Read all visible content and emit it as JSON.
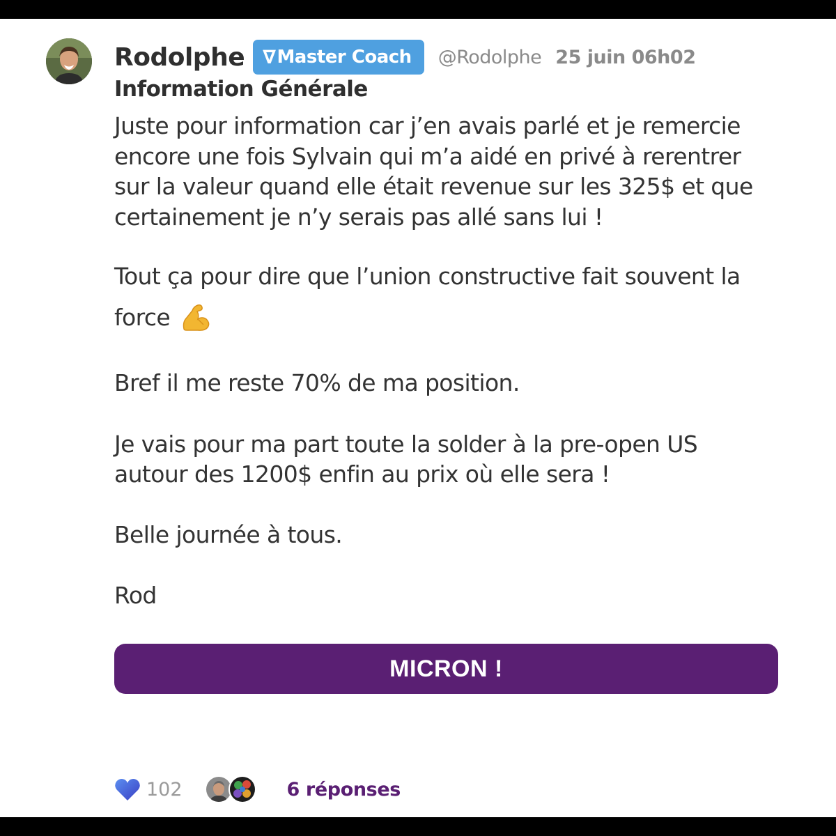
{
  "post": {
    "author": "Rodolphe",
    "badge_label": "Master Coach",
    "badge_logo": "∇",
    "handle": "@Rodolphe",
    "timestamp": "25 juin 06h02",
    "title": "Information Générale",
    "body_lines": [
      "Juste pour information car j’en avais parlé et je remercie",
      "encore une fois Sylvain qui m’a aidé en privé à rerentrer",
      "sur la valeur quand elle était revenue sur les 325$ et que",
      "certainement je n’y serais pas allé sans lui !"
    ],
    "para2_line1": "Tout ça pour dire que l’union constructive fait souvent la",
    "para2_line2": "force",
    "para3": "Bref il me reste 70% de ma position.",
    "para4_lines": [
      "Je vais pour ma part toute la solder à la pre-open US",
      "autour des 1200$ enfin au prix où elle sera !"
    ],
    "para5": "Belle journée à tous.",
    "signature": "Rod",
    "emoji_icon": "flexed-biceps-icon"
  },
  "cta": {
    "label": "MICRON !"
  },
  "footer": {
    "like_count": "102",
    "replies_label": "6 réponses",
    "heart_color": "#4a62d8"
  },
  "colors": {
    "badge": "#4fa0e0",
    "cta": "#5a1f73",
    "text": "#333333",
    "muted": "#8a8a8a"
  }
}
